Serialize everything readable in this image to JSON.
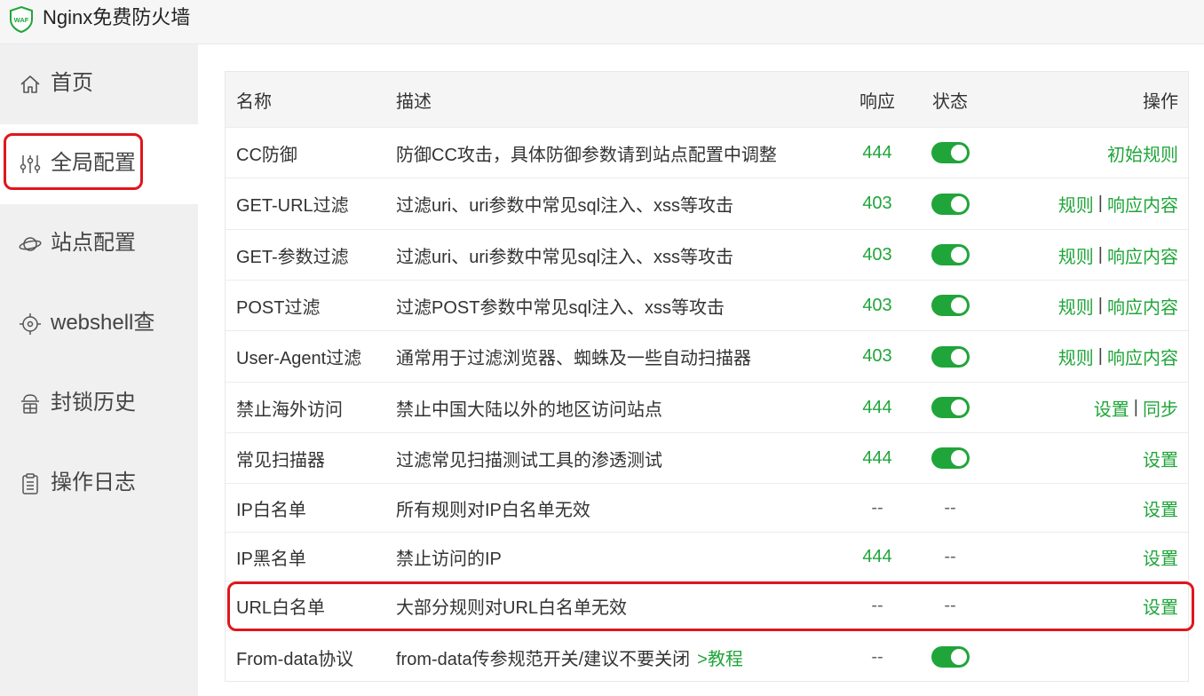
{
  "app": {
    "title": "Nginx免费防火墙",
    "logo_text": "WAF",
    "accent": "#20a53a",
    "highlight": "#e0161c"
  },
  "sidebar": {
    "items": [
      {
        "label": "首页",
        "icon": "home-icon"
      },
      {
        "label": "全局配置",
        "icon": "sliders-icon",
        "active": true
      },
      {
        "label": "站点配置",
        "icon": "planet-icon"
      },
      {
        "label": "webshell查",
        "icon": "target-icon"
      },
      {
        "label": "封锁历史",
        "icon": "history-icon"
      },
      {
        "label": "操作日志",
        "icon": "clipboard-icon"
      }
    ]
  },
  "table": {
    "headers": {
      "name": "名称",
      "desc": "描述",
      "resp": "响应",
      "status": "状态",
      "ops": "操作"
    },
    "rows": [
      {
        "name": "CC防御",
        "desc": "防御CC攻击，具体防御参数请到站点配置中调整",
        "resp": "444",
        "status": "on",
        "ops": [
          "初始规则"
        ]
      },
      {
        "name": "GET-URL过滤",
        "desc": "过滤uri、uri参数中常见sql注入、xss等攻击",
        "resp": "403",
        "status": "on",
        "ops": [
          "规则",
          "响应内容"
        ]
      },
      {
        "name": "GET-参数过滤",
        "desc": "过滤uri、uri参数中常见sql注入、xss等攻击",
        "resp": "403",
        "status": "on",
        "ops": [
          "规则",
          "响应内容"
        ]
      },
      {
        "name": "POST过滤",
        "desc": "过滤POST参数中常见sql注入、xss等攻击",
        "resp": "403",
        "status": "on",
        "ops": [
          "规则",
          "响应内容"
        ]
      },
      {
        "name": "User-Agent过滤",
        "desc": "通常用于过滤浏览器、蜘蛛及一些自动扫描器",
        "resp": "403",
        "status": "on",
        "ops": [
          "规则",
          "响应内容"
        ]
      },
      {
        "name": "禁止海外访问",
        "desc": "禁止中国大陆以外的地区访问站点",
        "resp": "444",
        "status": "on",
        "ops": [
          "设置",
          "同步"
        ]
      },
      {
        "name": "常见扫描器",
        "desc": "过滤常见扫描测试工具的渗透测试",
        "resp": "444",
        "status": "on",
        "ops": [
          "设置"
        ]
      },
      {
        "name": "IP白名单",
        "desc": "所有规则对IP白名单无效",
        "resp": "--",
        "status": "--",
        "ops": [
          "设置"
        ]
      },
      {
        "name": "IP黑名单",
        "desc": "禁止访问的IP",
        "resp": "444",
        "status": "--",
        "ops": [
          "设置"
        ]
      },
      {
        "name": "URL白名单",
        "desc": "大部分规则对URL白名单无效",
        "resp": "--",
        "status": "--",
        "ops": [
          "设置"
        ]
      },
      {
        "name": "From-data协议",
        "desc": "from-data传参规范开关/建议不要关闭",
        "desc_link": ">教程",
        "resp": "--",
        "status": "on",
        "ops": []
      }
    ]
  }
}
